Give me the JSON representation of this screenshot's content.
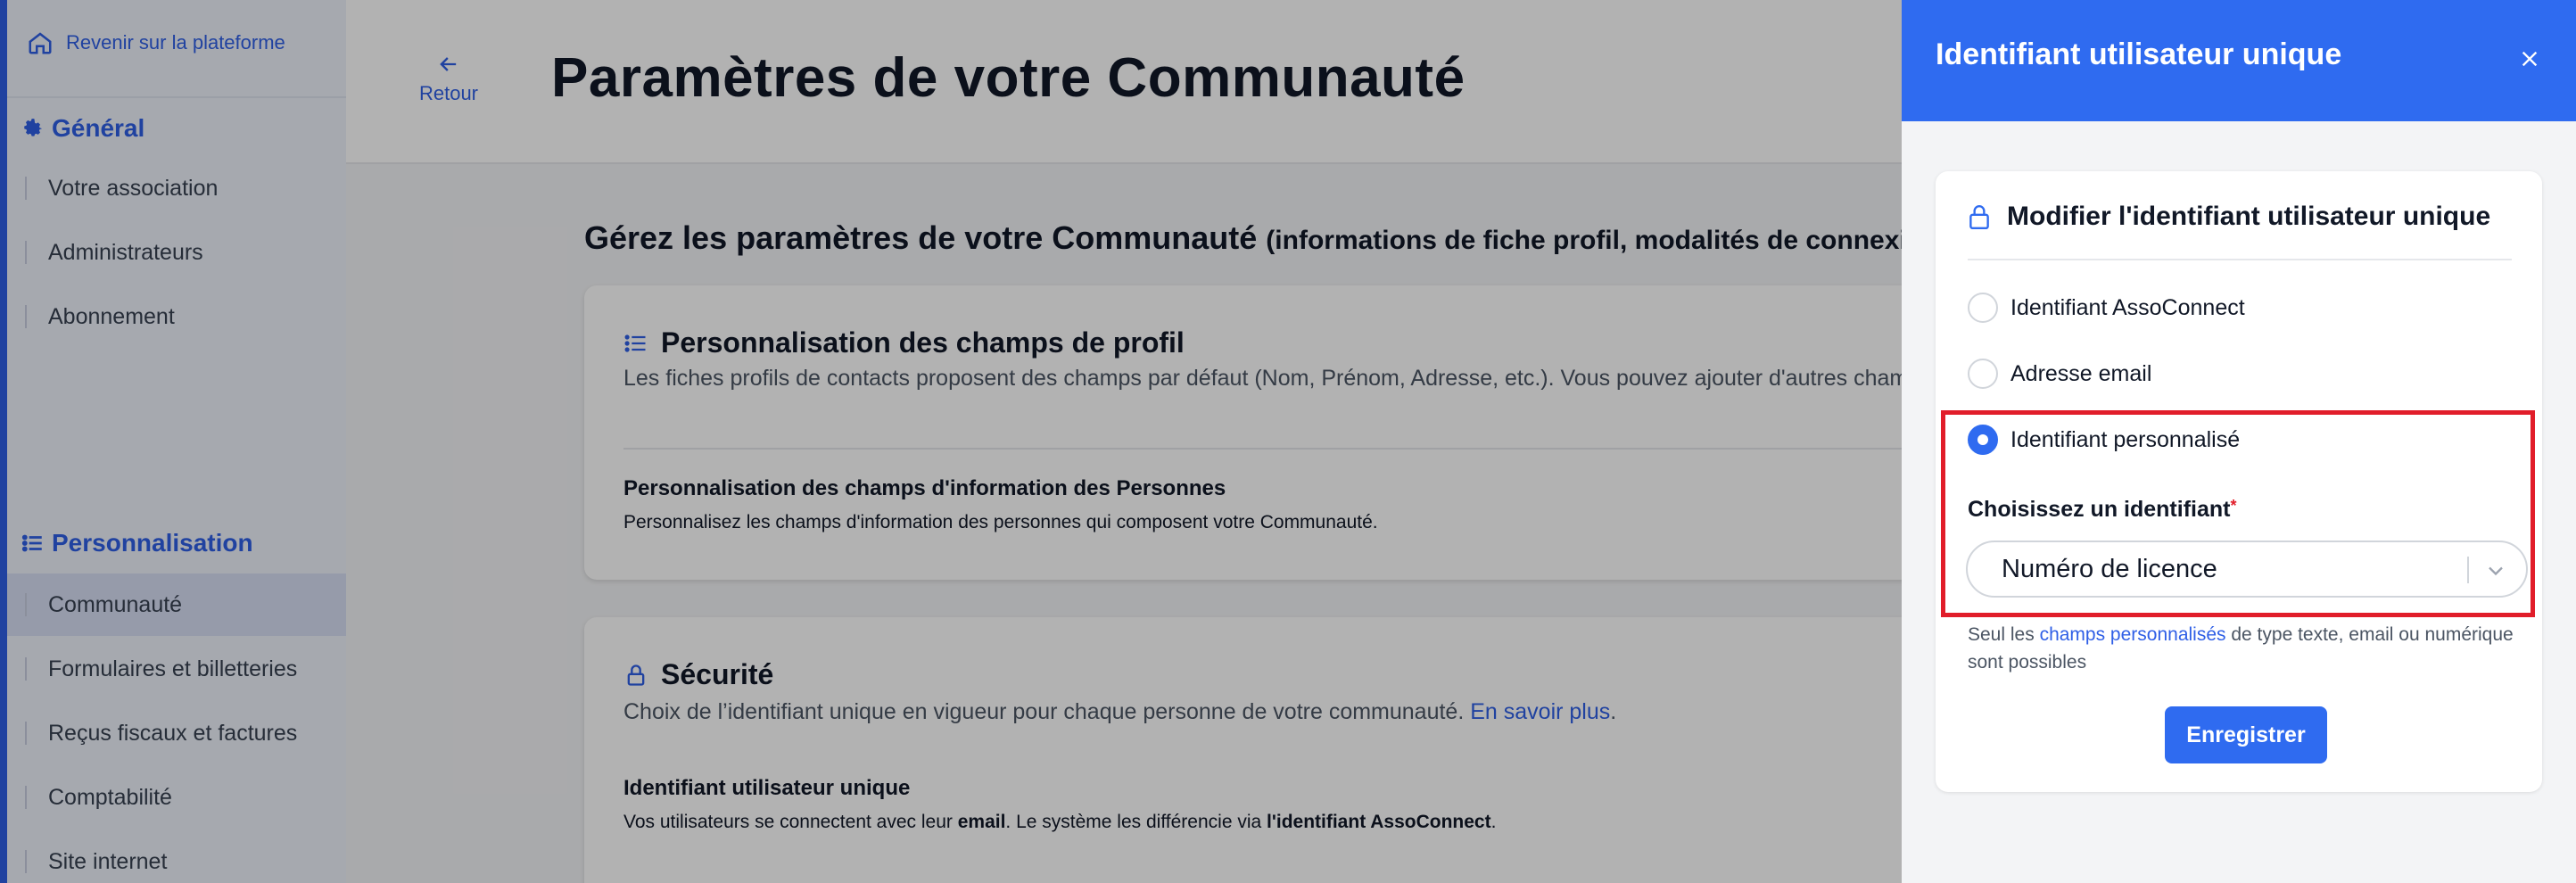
{
  "sidebar": {
    "back_label": "Revenir sur la plateforme",
    "section_general": "Général",
    "general_items": [
      "Votre association",
      "Administrateurs",
      "Abonnement"
    ],
    "section_personnalisation": "Personnalisation",
    "perso_items": [
      "Communauté",
      "Formulaires et billetteries",
      "Reçus fiscaux et factures",
      "Comptabilité",
      "Site internet"
    ]
  },
  "header": {
    "back_label": "Retour",
    "page_title": "Paramètres de votre Communauté"
  },
  "main": {
    "subtitle": "Gérez les paramètres de votre Communauté",
    "subtitle_small": "(informations de fiche profil, modalités de connexion)",
    "profile_card": {
      "title": "Personnalisation des champs de profil",
      "description": "Les fiches profils de contacts proposent des champs par défaut (Nom, Prénom, Adresse, etc.). Vous pouvez ajouter d'autres champs selon vos besoins.",
      "sub_title": "Personnalisation des champs d'information des Personnes",
      "sub_text": "Personnalisez les champs d'information des personnes qui composent votre Communauté."
    },
    "security_card": {
      "title": "Sécurité",
      "description": "Choix de l’identifiant unique en vigueur pour chaque personne de votre communauté.",
      "learn_more": "En savoir plus",
      "sub_title": "Identifiant utilisateur unique",
      "sub_text_1": "Vos utilisateurs se connectent avec leur",
      "sub_text_bold_1": "email",
      "sub_text_2": ". Le système les différencie via",
      "sub_text_bold_2": "l'identifiant AssoConnect",
      "sub_text_3": "."
    }
  },
  "drawer": {
    "title": "Identifiant utilisateur unique",
    "panel_title": "Modifier l'identifiant utilisateur unique",
    "options": [
      {
        "label": "Identifiant AssoConnect",
        "checked": false
      },
      {
        "label": "Adresse email",
        "checked": false
      },
      {
        "label": "Identifiant personnalisé",
        "checked": true
      }
    ],
    "field_label": "Choisissez un identifiant",
    "required_mark": "*",
    "selected_value": "Numéro de licence",
    "help_prefix": "Seul les",
    "help_link": "champs personnalisés",
    "help_suffix": "de type texte, email ou numérique sont possibles",
    "save_label": "Enregistrer"
  },
  "colors": {
    "accent": "#2f6bf0",
    "highlight": "#e11d2a",
    "overlay": "rgba(0,0,0,0.30)"
  }
}
